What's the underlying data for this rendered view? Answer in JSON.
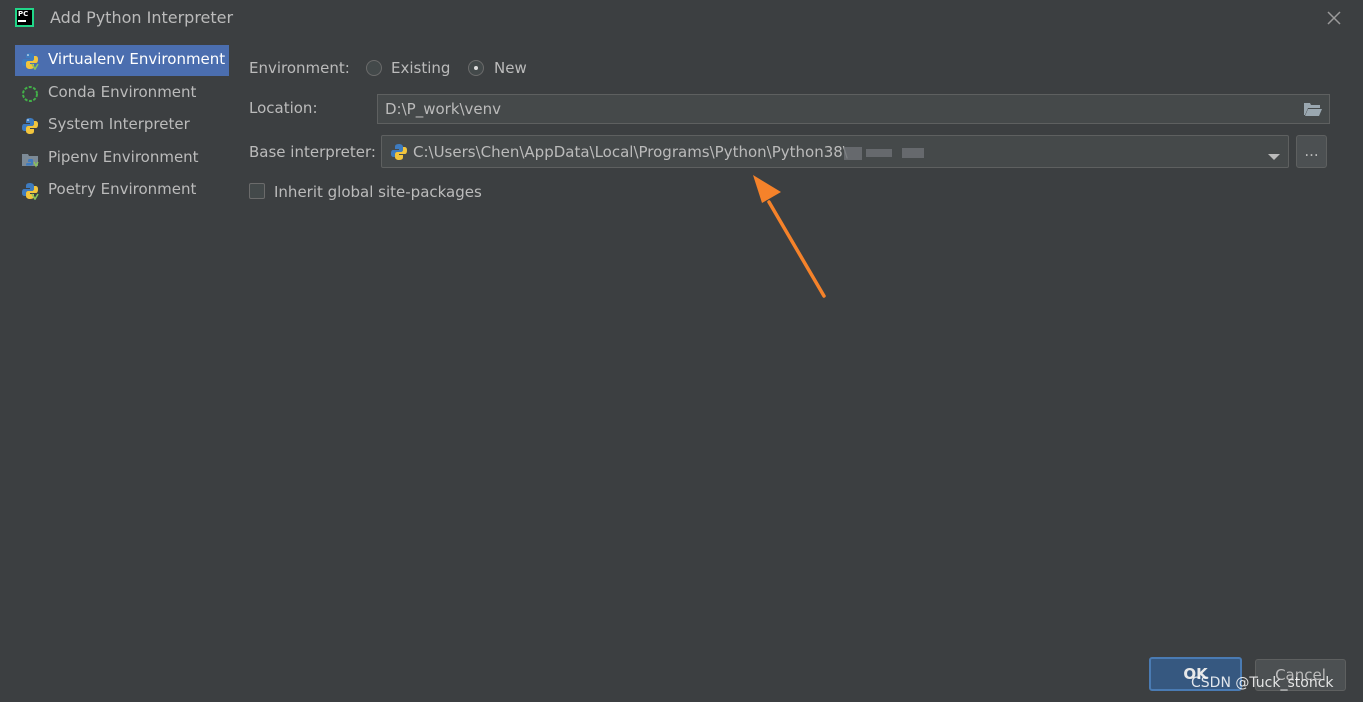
{
  "window": {
    "title": "Add Python Interpreter",
    "logo_text": "PC"
  },
  "sidebar": {
    "items": [
      {
        "label": "Virtualenv Environment",
        "icon": "python-virtualenv-icon",
        "selected": true
      },
      {
        "label": "Conda Environment",
        "icon": "conda-icon",
        "selected": false
      },
      {
        "label": "System Interpreter",
        "icon": "python-icon",
        "selected": false
      },
      {
        "label": "Pipenv Environment",
        "icon": "pipenv-icon",
        "selected": false
      },
      {
        "label": "Poetry Environment",
        "icon": "poetry-icon",
        "selected": false
      }
    ]
  },
  "form": {
    "environment_label": "Environment:",
    "existing_label": "Existing",
    "new_label": "New",
    "selected_environment": "New",
    "location_label": "Location:",
    "location_value": "D:\\P_work\\venv",
    "base_interpreter_label": "Base interpreter:",
    "base_interpreter_value": "C:\\Users\\Chen\\AppData\\Local\\Programs\\Python\\Python38\\",
    "browse_label": "...",
    "inherit_label": "Inherit global site-packages",
    "inherit_checked": false
  },
  "footer": {
    "ok_label": "OK",
    "cancel_label": "Cancel"
  },
  "watermark": "CSDN @Tuck_stonck",
  "colors": {
    "background": "#3c3f41",
    "selection": "#4b6eaf",
    "annotation_arrow": "#f5822a"
  }
}
